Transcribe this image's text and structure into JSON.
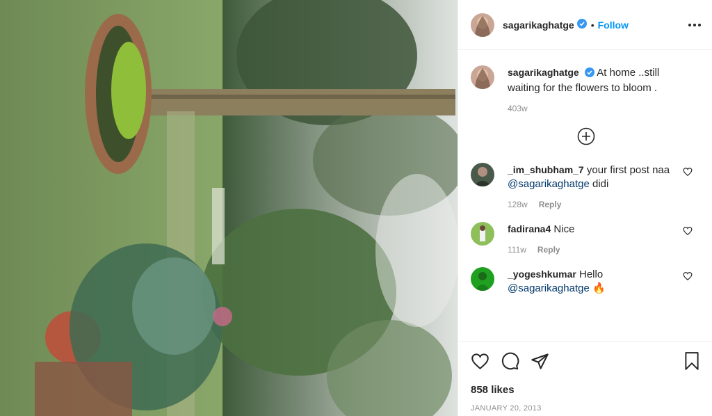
{
  "post": {
    "author": "sagarikaghatge",
    "follow_label": "Follow",
    "separator": "•",
    "caption": "At home ..still waiting for the flowers to bloom .",
    "caption_age": "403w",
    "likes": "858 likes",
    "date": "JANUARY 20, 2013"
  },
  "comments": [
    {
      "user": "_im_shubham_7",
      "text_before": "your first post naa ",
      "mention": "@sagarikaghatge",
      "text_after": " didi",
      "age": "128w",
      "reply": "Reply"
    },
    {
      "user": "fadirana4",
      "text_before": "Nice",
      "mention": "",
      "text_after": "",
      "age": "111w",
      "reply": "Reply"
    },
    {
      "user": "_yogeshkumar",
      "text_before": "Hello ",
      "mention": "@sagarikaghatge",
      "text_after": " 🔥",
      "age": "",
      "reply": ""
    }
  ],
  "icons": {
    "verified": "verified-badge-icon",
    "more": "more-options-icon",
    "load_more": "plus-circle-icon",
    "like": "heart-icon",
    "comment": "comment-icon",
    "share": "paper-plane-icon",
    "save": "bookmark-icon"
  },
  "colors": {
    "accent": "#0095f6",
    "mention": "#00376b",
    "muted": "#8e8e8e",
    "text": "#262626"
  }
}
